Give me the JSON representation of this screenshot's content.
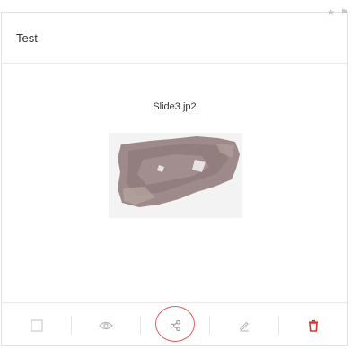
{
  "card": {
    "title": "Test",
    "filename": "Slide3.jp2"
  },
  "corner_icons": [
    "star-icon",
    "flag-icon"
  ],
  "actions": [
    {
      "name": "select-checkbox",
      "icon": "checkbox-icon"
    },
    {
      "name": "view-button",
      "icon": "eye-icon"
    },
    {
      "name": "share-button",
      "icon": "share-icon",
      "highlighted": true
    },
    {
      "name": "edit-button",
      "icon": "pencil-icon"
    },
    {
      "name": "delete-button",
      "icon": "trash-icon"
    }
  ],
  "colors": {
    "icon_gray": "#b5b5b5",
    "delete_red": "#e03030",
    "highlight_ring": "#e25b5b",
    "tissue": "#9a8383"
  }
}
